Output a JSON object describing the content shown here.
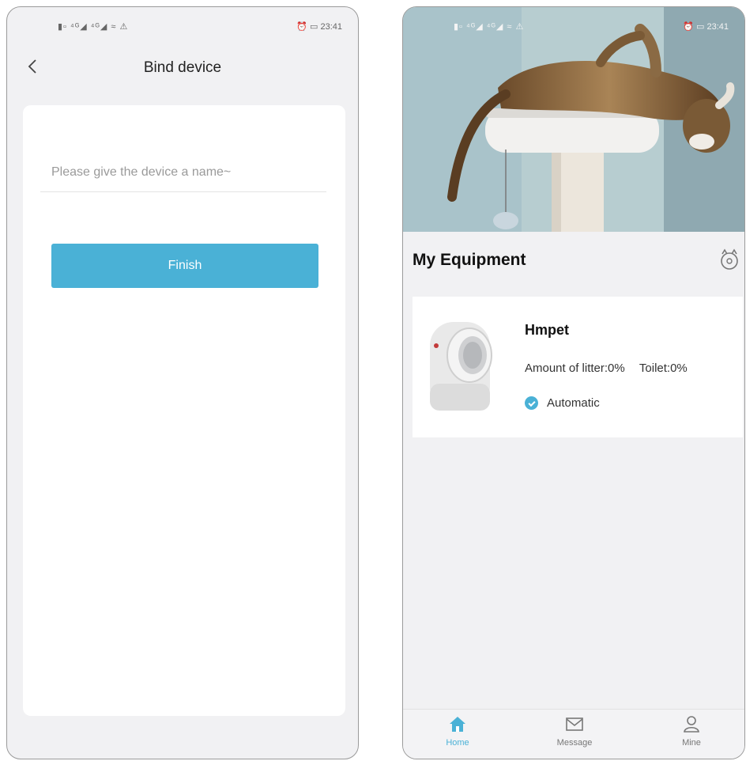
{
  "left_screen": {
    "status_bar": {
      "left": "▮▫ ⁴ᴳ◢ ⁴ᴳ◢ ≈ ⚠",
      "right": "⏰ ▭ 23:41"
    },
    "header": {
      "title": "Bind device"
    },
    "name_field": {
      "value": "",
      "placeholder": "Please give the device a name~"
    },
    "finish_button": {
      "label": "Finish"
    }
  },
  "right_screen": {
    "status_bar": {
      "left": "▮▫ ⁴ᴳ◢ ⁴ᴳ◢ ≈ ⚠",
      "right": "⏰ ▭ 23:41"
    },
    "section_title": "My Equipment",
    "device": {
      "name": "Hmpet",
      "litter_amount": "Amount of litter:0%",
      "toilet": "Toilet:0%",
      "mode": "Automatic"
    },
    "nav": [
      {
        "label": "Home",
        "icon": "home-icon",
        "active": true
      },
      {
        "label": "Message",
        "icon": "envelope-icon",
        "active": false
      },
      {
        "label": "Mine",
        "icon": "person-icon",
        "active": false
      }
    ]
  },
  "colors": {
    "accent": "#4ab1d6",
    "screen_background": "#f1f1f3",
    "card": "#ffffff"
  }
}
